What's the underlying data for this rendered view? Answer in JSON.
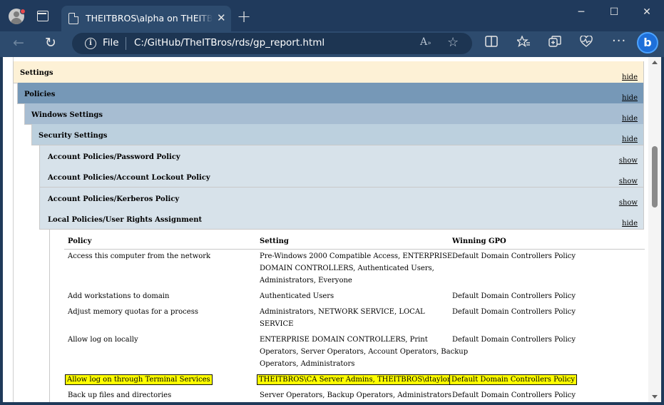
{
  "browser": {
    "tab_title": "THEITBROS\\alpha on THEITBROS",
    "tab_close": "✕",
    "new_tab": "+",
    "window_controls": {
      "minimize": "─",
      "maximize": "☐",
      "close": "✕"
    },
    "address": {
      "scheme_label": "File",
      "url": "C:/GitHub/TheITBros/rds/gp_report.html"
    },
    "icons": [
      "profile-avatar-icon",
      "tab-actions-icon",
      "back-icon",
      "refresh-icon",
      "info-icon",
      "read-aloud-icon",
      "favorite-star-icon",
      "split-screen-icon",
      "favorites-icon",
      "collections-icon",
      "browser-essentials-icon",
      "more-icon",
      "copilot-icon"
    ]
  },
  "report": {
    "sections": [
      {
        "title": "Settings",
        "toggle": "hide"
      },
      {
        "title": "Policies",
        "toggle": "hide"
      },
      {
        "title": "Windows Settings",
        "toggle": "hide"
      },
      {
        "title": "Security Settings",
        "toggle": "hide"
      },
      {
        "title": "Account Policies/Password Policy",
        "toggle": "show"
      },
      {
        "title": "Account Policies/Account Lockout Policy",
        "toggle": "show"
      },
      {
        "title": "Account Policies/Kerberos Policy",
        "toggle": "show"
      },
      {
        "title": "Local Policies/User Rights Assignment",
        "toggle": "hide"
      }
    ],
    "table": {
      "headers": [
        "Policy",
        "Setting",
        "Winning GPO"
      ],
      "rows": [
        {
          "policy": "Access this computer from the network",
          "setting": [
            "Pre-Windows 2000 Compatible Access, ENTERPRISE",
            "DOMAIN CONTROLLERS, Authenticated Users,",
            "Administrators, Everyone"
          ],
          "gpo": "Default Domain Controllers Policy",
          "highlighted": false
        },
        {
          "policy": "Add workstations to domain",
          "setting": [
            "Authenticated Users"
          ],
          "gpo": "Default Domain Controllers Policy",
          "highlighted": false
        },
        {
          "policy": "Adjust memory quotas for a process",
          "setting": [
            "Administrators, NETWORK SERVICE, LOCAL",
            "SERVICE"
          ],
          "gpo": "Default Domain Controllers Policy",
          "highlighted": false
        },
        {
          "policy": "Allow log on locally",
          "setting": [
            "ENTERPRISE DOMAIN CONTROLLERS, Print",
            "Operators, Server Operators, Account Operators, Backup",
            "Operators, Administrators"
          ],
          "gpo": "Default Domain Controllers Policy",
          "highlighted": false
        },
        {
          "policy": "Allow log on through Terminal Services",
          "setting": [
            "THEITBROS\\CA Server Admins, THEITBROS\\dtaylor"
          ],
          "gpo": "Default Domain Controllers Policy",
          "highlighted": true
        },
        {
          "policy": "Back up files and directories",
          "setting": [
            "Server Operators, Backup Operators, Administrators"
          ],
          "gpo": "Default Domain Controllers Policy",
          "highlighted": false
        }
      ]
    }
  },
  "colors": {
    "settings_bg": "#fdf1d6",
    "policies_bg": "#7698b7",
    "windows_settings_bg": "#a7bdd2",
    "security_settings_bg": "#bcd0de",
    "subsection_bg": "#d7e2ea",
    "highlight": "#ffff00"
  }
}
